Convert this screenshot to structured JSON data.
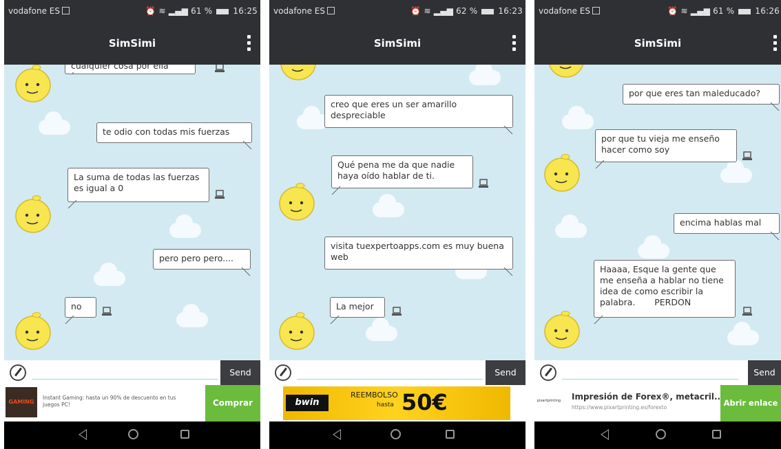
{
  "colors": {
    "header": "#2e3033",
    "chat_bg": "#d3eaf2",
    "simsimi_yellow": "#f7e64f",
    "ad_green": "#6bbb3c",
    "bwin_yellow": "#f5c400"
  },
  "screens": [
    {
      "status": {
        "carrier": "vodafone ES",
        "battery": "61 %",
        "time": "16:25"
      },
      "app_title": "SimSimi",
      "messages": [
        {
          "from": "simsimi",
          "text": "cualquier cosa por ella"
        },
        {
          "from": "user",
          "text": "te odio con todas mis fuerzas"
        },
        {
          "from": "simsimi",
          "text": "La suma de todas las fuerzas es igual a 0"
        },
        {
          "from": "user",
          "text": "pero pero pero...."
        },
        {
          "from": "simsimi",
          "text": "no"
        }
      ],
      "send_label": "Send",
      "ad": {
        "brand_text": "GAMING",
        "text": "Instant Gaming: hasta un 90% de descuento en tus juegos PC!",
        "button": "Comprar"
      }
    },
    {
      "status": {
        "carrier": "vodafone ES",
        "battery": "62 %",
        "time": "16:23"
      },
      "app_title": "SimSimi",
      "messages": [
        {
          "from": "user",
          "text": "creo que eres un ser amarillo despreciable"
        },
        {
          "from": "simsimi",
          "text": "Qué pena me da que nadie haya oído hablar de ti."
        },
        {
          "from": "user",
          "text": "visita tuexpertoapps.com es muy buena web"
        },
        {
          "from": "simsimi",
          "text": "La mejor"
        }
      ],
      "send_label": "Send",
      "ad": {
        "brand": "bwin",
        "line1": "REEMBOLSO",
        "line2": "hasta",
        "amount": "50€"
      }
    },
    {
      "status": {
        "carrier": "vodafone ES",
        "battery": "61 %",
        "time": "16:26"
      },
      "app_title": "SimSimi",
      "messages": [
        {
          "from": "user",
          "text": "por que eres tan maleducado?"
        },
        {
          "from": "simsimi",
          "text": "por que tu vieja me enseño hacer como soy"
        },
        {
          "from": "user",
          "text": "encima hablas mal"
        },
        {
          "from": "simsimi",
          "text": "Haaaa, Esque la gente que me enseña a hablar no tiene idea de como escribir la palabra.       PERDON"
        }
      ],
      "send_label": "Send",
      "ad": {
        "title": "Impresión de Forex®, metacril...",
        "url": "https://www.pixartprinting.es/forexto",
        "button": "Abrir enlace"
      }
    }
  ]
}
